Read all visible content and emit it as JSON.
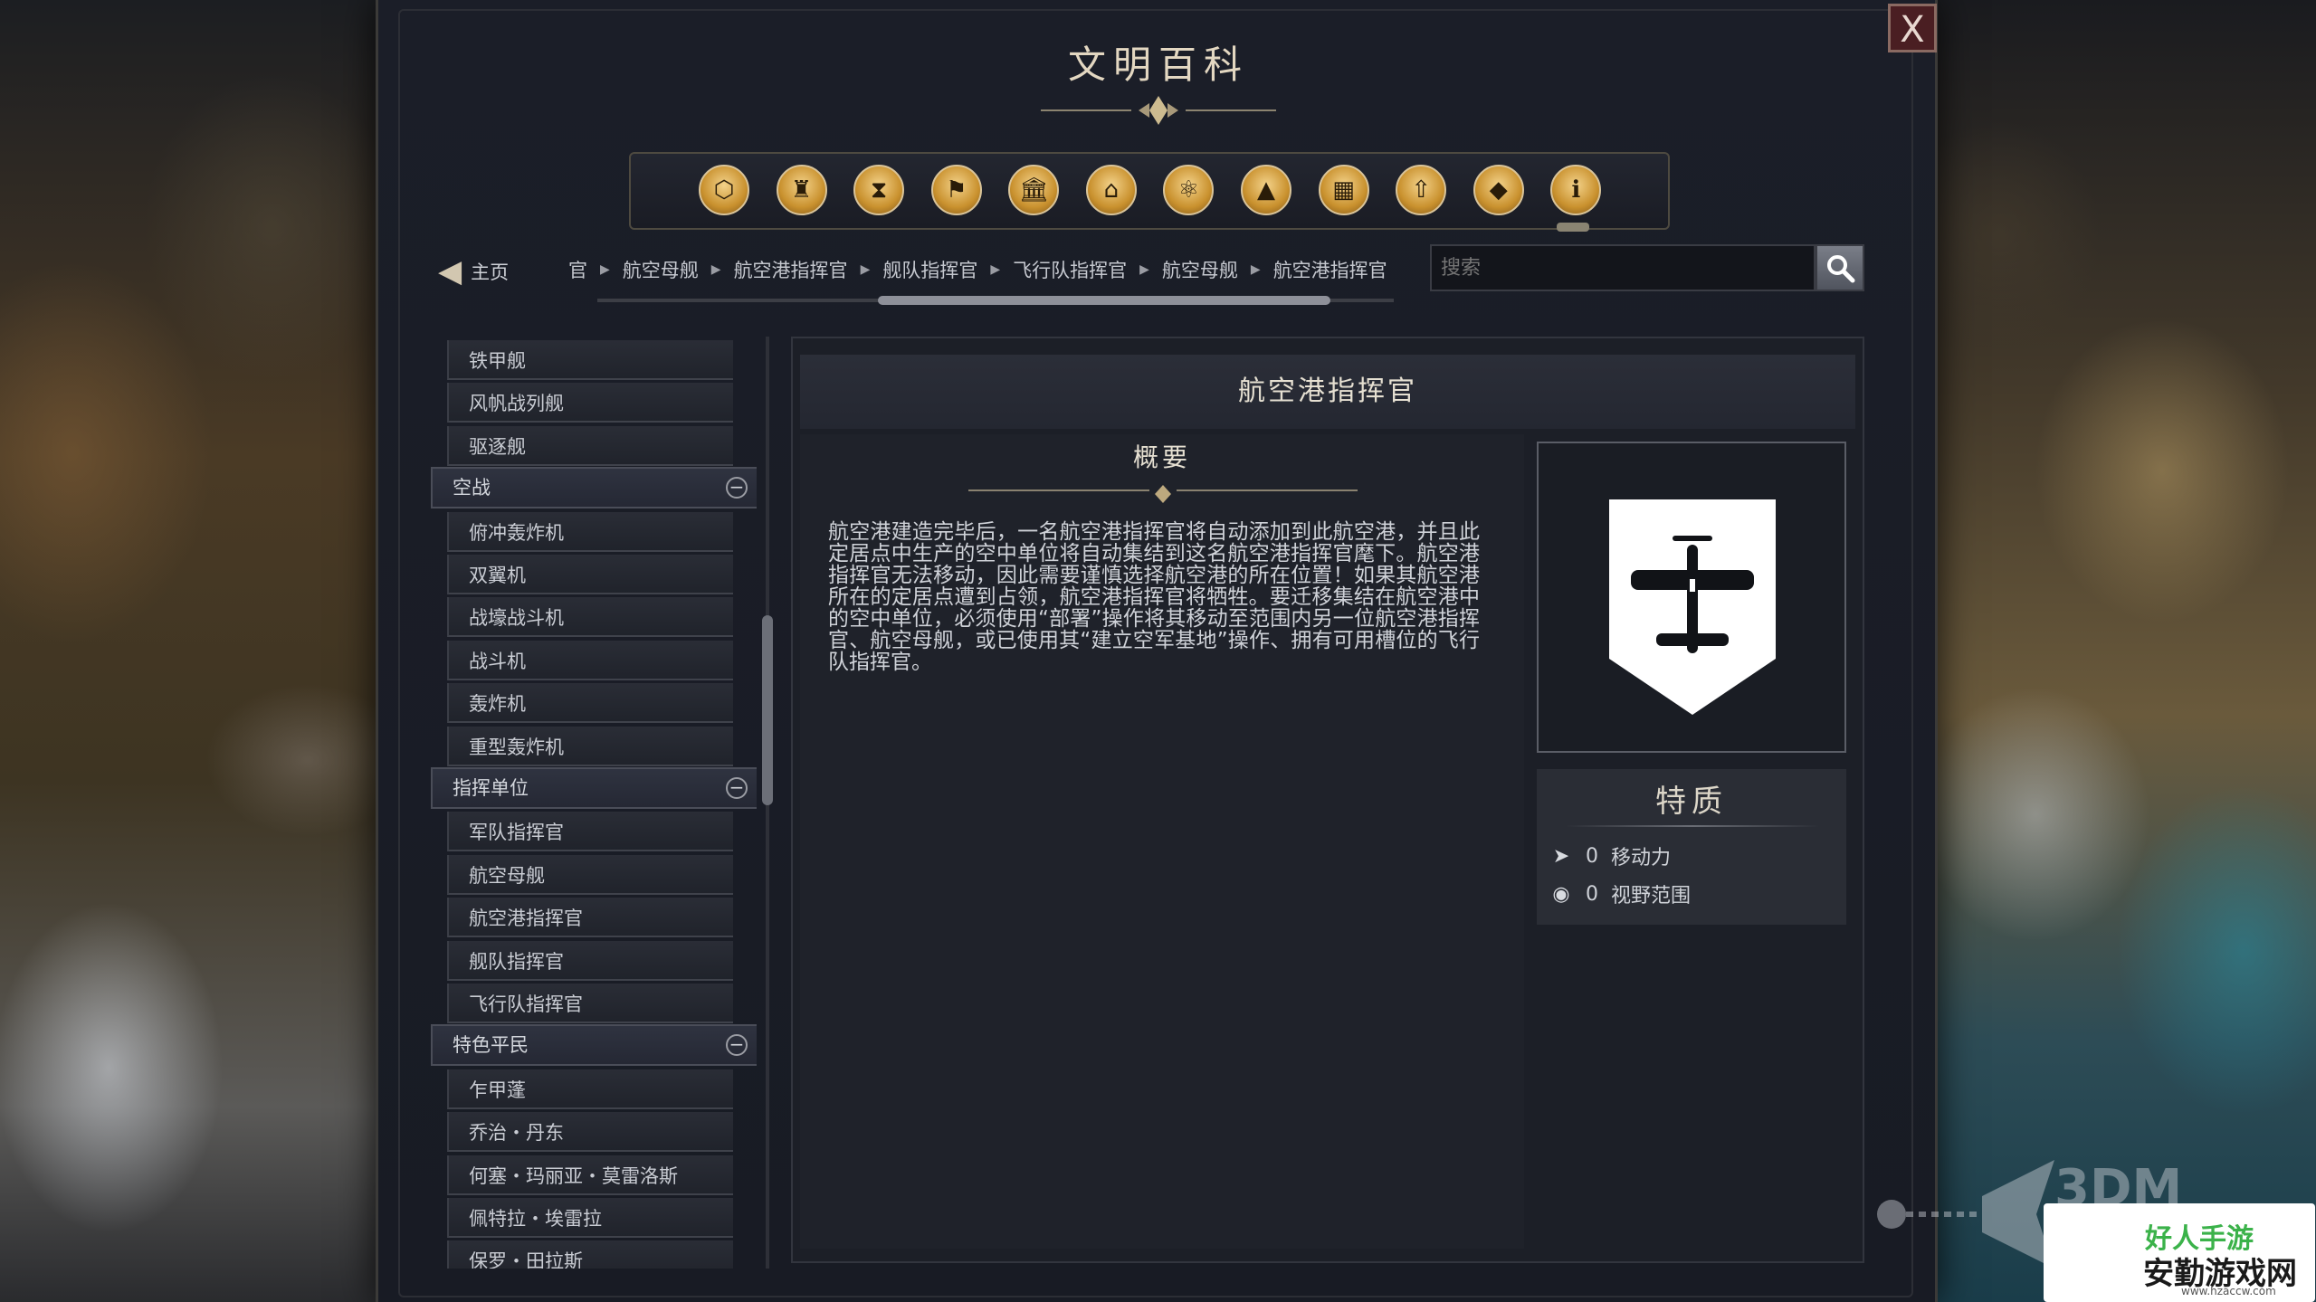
{
  "window": {
    "title": "文明百科",
    "close_label": "X"
  },
  "categories": [
    {
      "name": "units-icon",
      "glyph": "⬡"
    },
    {
      "name": "governors-icon",
      "glyph": "♜"
    },
    {
      "name": "eras-icon",
      "glyph": "⧗"
    },
    {
      "name": "civilizations-icon",
      "glyph": "⚑"
    },
    {
      "name": "buildings-icon",
      "glyph": "🏛"
    },
    {
      "name": "wonders-icon",
      "glyph": "⌂"
    },
    {
      "name": "technology-icon",
      "glyph": "⚛"
    },
    {
      "name": "terrain-icon",
      "glyph": "▲"
    },
    {
      "name": "districts-icon",
      "glyph": "▦"
    },
    {
      "name": "upgrades-icon",
      "glyph": "⇧"
    },
    {
      "name": "resources-icon",
      "glyph": "◆"
    },
    {
      "name": "info-icon",
      "glyph": "ℹ"
    }
  ],
  "nav": {
    "home_label": "主页",
    "breadcrumbs": [
      "官",
      "航空母舰",
      "航空港指挥官",
      "舰队指挥官",
      "飞行队指挥官",
      "航空母舰",
      "航空港指挥官"
    ],
    "search_placeholder": "搜索"
  },
  "sidebar": {
    "entries": [
      {
        "type": "item",
        "label": "铁甲舰"
      },
      {
        "type": "item",
        "label": "风帆战列舰"
      },
      {
        "type": "item",
        "label": "驱逐舰"
      },
      {
        "type": "header",
        "label": "空战"
      },
      {
        "type": "item",
        "label": "俯冲轰炸机"
      },
      {
        "type": "item",
        "label": "双翼机"
      },
      {
        "type": "item",
        "label": "战壕战斗机"
      },
      {
        "type": "item",
        "label": "战斗机"
      },
      {
        "type": "item",
        "label": "轰炸机"
      },
      {
        "type": "item",
        "label": "重型轰炸机"
      },
      {
        "type": "header",
        "label": "指挥单位"
      },
      {
        "type": "item",
        "label": "军队指挥官"
      },
      {
        "type": "item",
        "label": "航空母舰"
      },
      {
        "type": "item",
        "label": "航空港指挥官"
      },
      {
        "type": "item",
        "label": "舰队指挥官"
      },
      {
        "type": "item",
        "label": "飞行队指挥官"
      },
      {
        "type": "header",
        "label": "特色平民"
      },
      {
        "type": "item",
        "label": "乍甲蓬"
      },
      {
        "type": "item",
        "label": "乔治・丹东"
      },
      {
        "type": "item",
        "label": "何塞・玛丽亚・莫雷洛斯"
      },
      {
        "type": "item",
        "label": "佩特拉・埃雷拉"
      },
      {
        "type": "item",
        "label": "保罗・田拉斯"
      }
    ]
  },
  "content": {
    "title": "航空港指挥官",
    "overview_title": "概要",
    "overview_text": "航空港建造完毕后，一名航空港指挥官将自动添加到此航空港，并且此定居点中生产的空中单位将自动集结到这名航空港指挥官麾下。航空港指挥官无法移动，因此需要谨慎选择航空港的所在位置！如果其航空港所在的定居点遭到占领，航空港指挥官将牺牲。要迁移集结在航空港中的空中单位，必须使用“部署”操作将其移动至范围内另一位航空港指挥官、航空母舰，或已使用其“建立空军基地”操作、拥有可用槽位的飞行队指挥官。",
    "portrait_icon": "airplane-icon",
    "traits_title": "特质",
    "traits": [
      {
        "icon": "movement-arrow-icon",
        "value": "0",
        "label": "移动力"
      },
      {
        "icon": "eye-icon",
        "value": "0",
        "label": "视野范围"
      }
    ]
  },
  "watermark": {
    "top_text": "3DM",
    "brand_top": "好人手游",
    "brand_text": "安勤游戏网",
    "url": "www.hzaccw.com"
  },
  "colors": {
    "accent_gold": "#c9912e",
    "close_red": "#4a1e22",
    "panel_bg": "#1c1f27"
  }
}
